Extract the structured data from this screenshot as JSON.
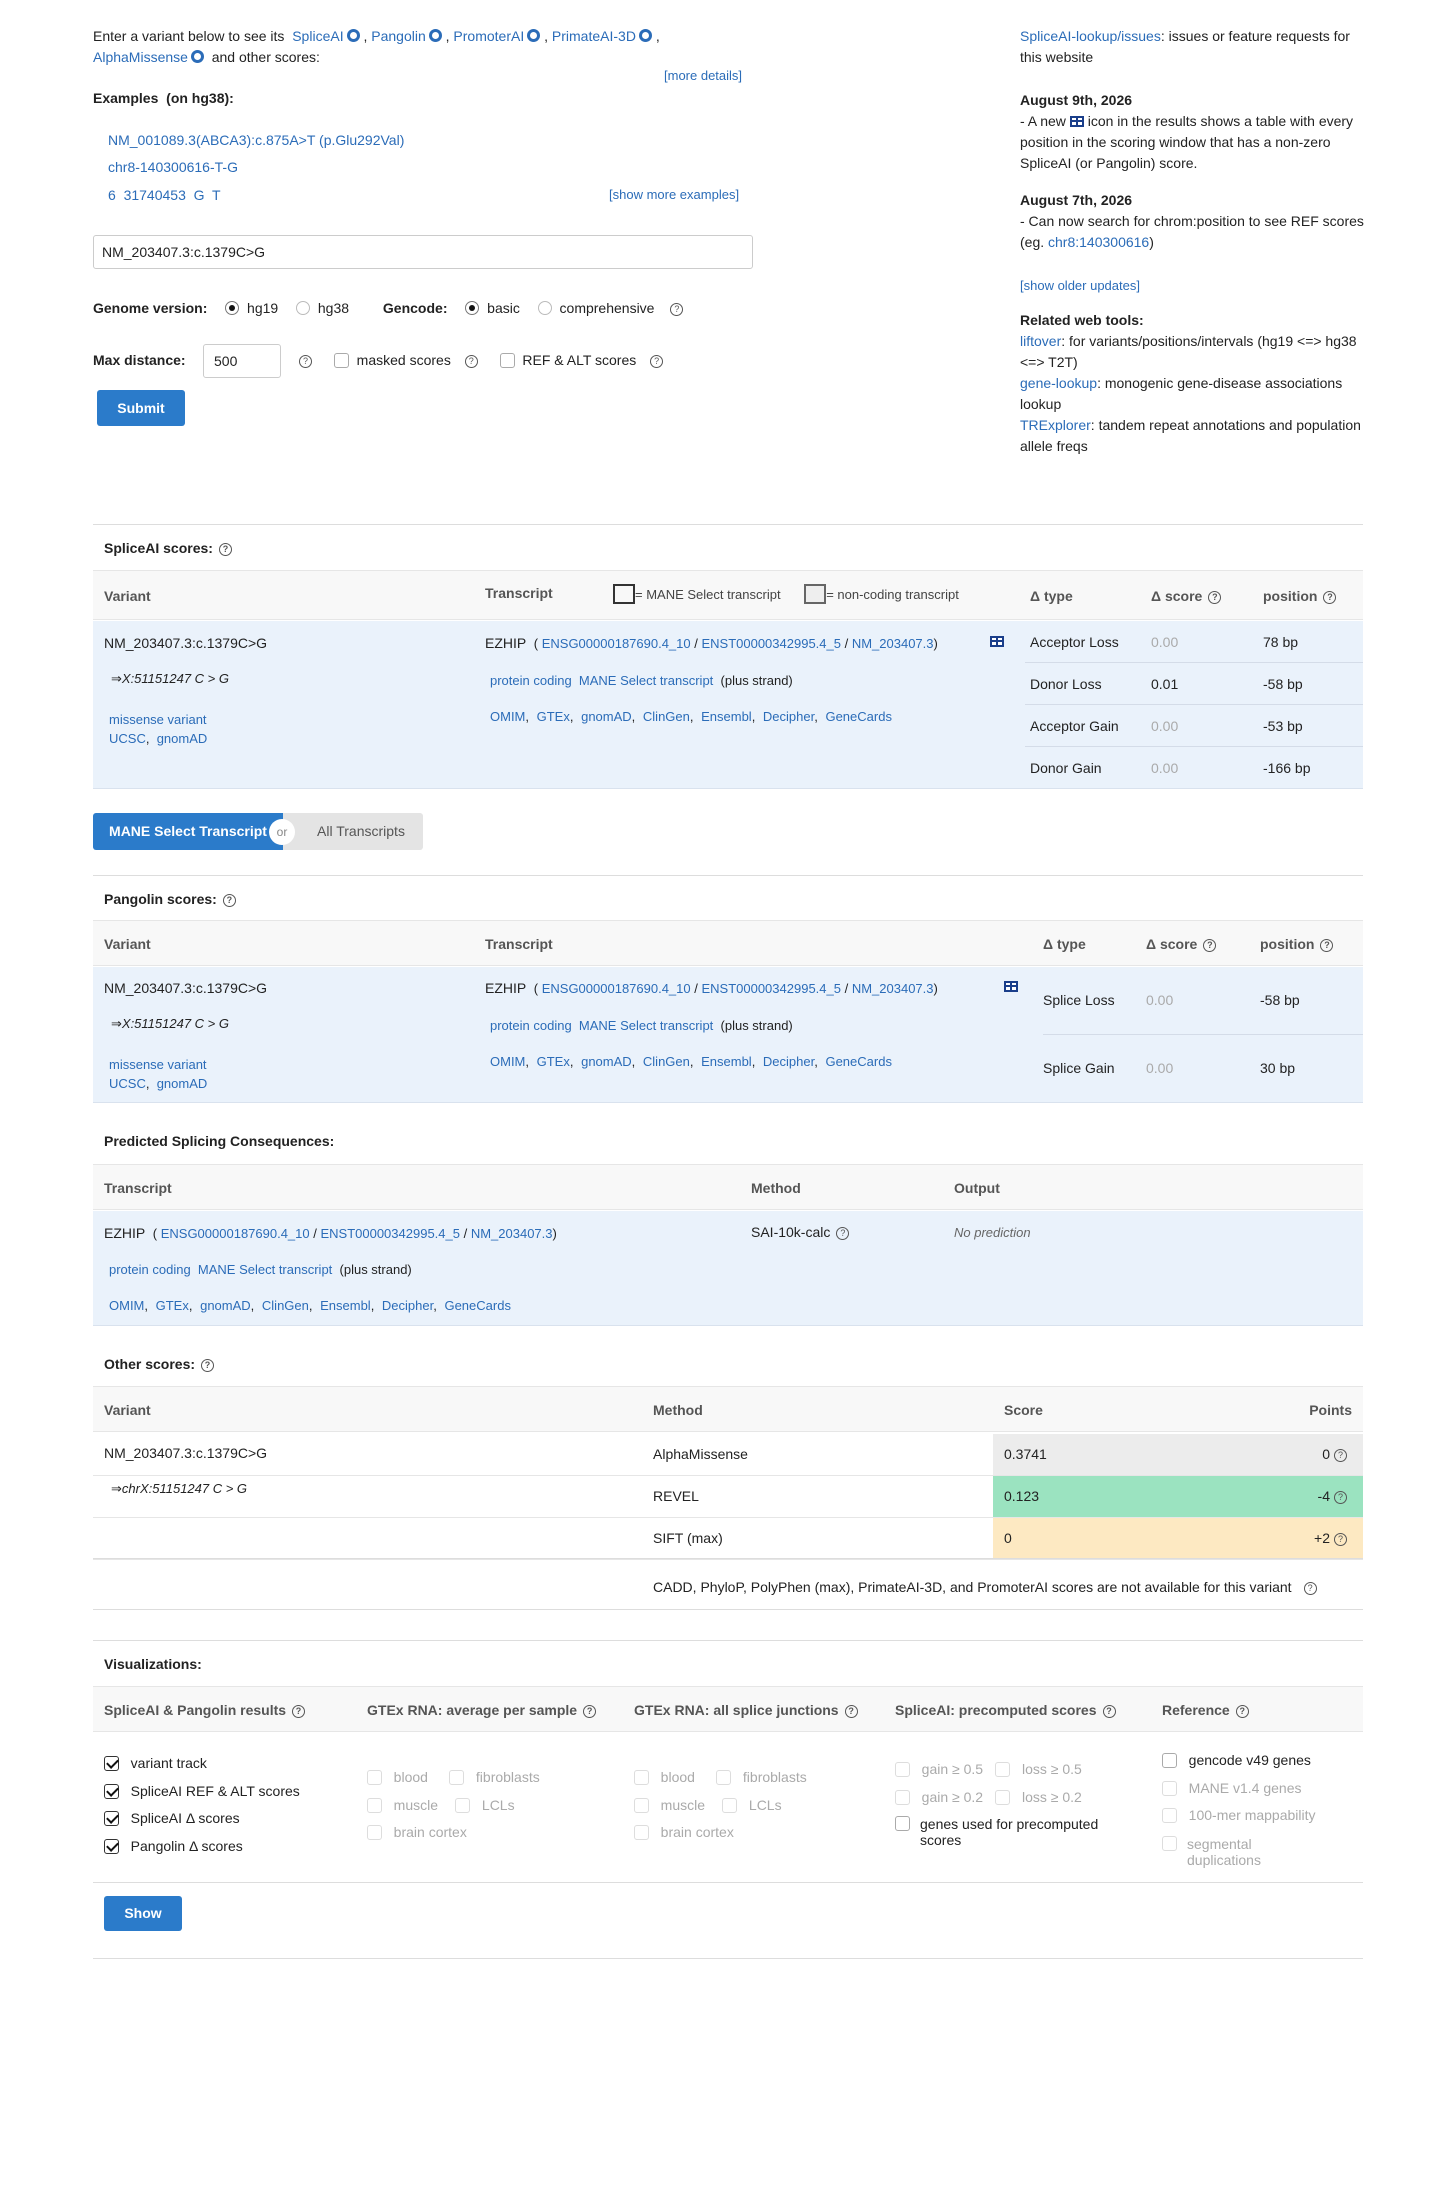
{
  "intro": {
    "prefix": "Enter a variant below to see its",
    "tools": [
      "SpliceAI",
      "Pangolin",
      "PromoterAI",
      "PrimateAI-3D",
      "AlphaMissense"
    ],
    "suffix": "and other scores:",
    "more_details": "[more details]"
  },
  "examples": {
    "title": "Examples",
    "subtitle": "(on hg38):",
    "items": [
      "NM_001089.3(ABCA3):c.875A>T (p.Glu292Val)",
      "chr8-140300616-T-G",
      "6  31740453  G  T"
    ],
    "show_more": "[show more examples]"
  },
  "search": {
    "value": "NM_203407.3:c.1379C>G"
  },
  "genome": {
    "label": "Genome version:",
    "options": [
      "hg19",
      "hg38"
    ],
    "selected": "hg19"
  },
  "gencode": {
    "label": "Gencode:",
    "options": [
      "basic",
      "comprehensive"
    ],
    "selected": "basic"
  },
  "maxdist": {
    "label": "Max distance:",
    "value": "500",
    "masked": "masked scores",
    "refalt": "REF & ALT scores"
  },
  "submit": "Submit",
  "sidebar": {
    "issues_link": "SpliceAI-lookup/issues",
    "issues_text": ": issues or feature requests for this website",
    "u1_date": "August 9th, 2026",
    "u1_a": "- A new",
    "u1_b": "icon in the results shows a table with every position in the scoring window that has a non-zero SpliceAI (or Pangolin) score.",
    "u2_date": "August 7th, 2026",
    "u2_a": "- Can now search for chrom:position to see REF scores (eg.",
    "u2_link": "chr8:140300616",
    "u2_b": ")",
    "older": "[show older updates]",
    "tools_title": "Related web tools:",
    "t1_link": "liftover",
    "t1_text": ": for variants/positions/intervals (hg19 <=> hg38 <=> T2T)",
    "t2_link": "gene-lookup",
    "t2_text": ": monogenic gene-disease associations lookup",
    "t3_link": "TRExplorer",
    "t3_text": ": tandem repeat annotations and population allele freqs"
  },
  "spliceai": {
    "title": "SpliceAI scores:",
    "headers": {
      "variant": "Variant",
      "transcript": "Transcript",
      "mane_legend": "= MANE Select transcript",
      "noncoding_legend": "= non-coding transcript",
      "dtype": "Δ type",
      "dscore": "Δ score",
      "position": "position"
    },
    "rows": [
      {
        "type": "Acceptor Loss",
        "score": "0.00",
        "pos": "78 bp"
      },
      {
        "type": "Donor Loss",
        "score": "0.01",
        "pos": "-58 bp"
      },
      {
        "type": "Acceptor Gain",
        "score": "0.00",
        "pos": "-53 bp"
      },
      {
        "type": "Donor Gain",
        "score": "0.00",
        "pos": "-166 bp"
      }
    ]
  },
  "variant": {
    "hgvs": "NM_203407.3:c.1379C>G",
    "genomic": "⇒X:51151247 C > G",
    "genomic_chr": "⇒chrX:51151247 C > G",
    "consequence": "missense variant",
    "links": [
      "UCSC",
      "gnomAD"
    ]
  },
  "transcript": {
    "gene": "EZHIP",
    "ids": [
      "ENSG00000187690.4_10",
      "ENST00000342995.4_5",
      "NM_203407.3"
    ],
    "biotype": "protein coding",
    "mane": "MANE Select transcript",
    "strand": "(plus strand)",
    "links": [
      "OMIM",
      "GTEx",
      "gnomAD",
      "ClinGen",
      "Ensembl",
      "Decipher",
      "GeneCards"
    ]
  },
  "toggle": {
    "mane": "MANE Select Transcript",
    "or": "or",
    "all": "All Transcripts"
  },
  "pangolin": {
    "title": "Pangolin scores:",
    "rows": [
      {
        "type": "Splice Loss",
        "score": "0.00",
        "pos": "-58 bp"
      },
      {
        "type": "Splice Gain",
        "score": "0.00",
        "pos": "30 bp"
      }
    ]
  },
  "consequences": {
    "title": "Predicted Splicing Consequences:",
    "headers": [
      "Transcript",
      "Method",
      "Output"
    ],
    "method": "SAI-10k-calc",
    "output": "No prediction"
  },
  "other": {
    "title": "Other scores:",
    "headers": [
      "Variant",
      "Method",
      "Score",
      "Points"
    ],
    "rows": [
      {
        "method": "AlphaMissense",
        "score": "0.3741",
        "points": "0",
        "color": "#ececec"
      },
      {
        "method": "REVEL",
        "score": "0.123",
        "points": "-4",
        "color": "#9be3c0"
      },
      {
        "method": "SIFT (max)",
        "score": "0",
        "points": "+2",
        "color": "#fde9c2"
      }
    ],
    "note": "CADD,  PhyloP,  PolyPhen (max),  PrimateAI-3D,  and PromoterAI scores are not available for this variant"
  },
  "viz": {
    "title": "Visualizations:",
    "col1": {
      "title": "SpliceAI & Pangolin results",
      "items": [
        "variant track",
        "SpliceAI REF & ALT scores",
        "SpliceAI Δ  scores",
        "Pangolin Δ  scores"
      ]
    },
    "col2": {
      "title": "GTEx RNA: average per sample",
      "items": [
        "blood",
        "fibroblasts",
        "muscle",
        "LCLs",
        "brain cortex"
      ]
    },
    "col3": {
      "title": "GTEx RNA: all splice junctions",
      "items": [
        "blood",
        "fibroblasts",
        "muscle",
        "LCLs",
        "brain cortex"
      ]
    },
    "col4": {
      "title": "SpliceAI: precomputed scores",
      "items": [
        "gain ≥ 0.5",
        "loss ≥ 0.5",
        "gain ≥ 0.2",
        "loss ≥ 0.2",
        "genes used for precomputed scores"
      ]
    },
    "col5": {
      "title": "Reference",
      "items": [
        "gencode v49 genes",
        "MANE v1.4 genes",
        "100-mer mappability",
        "segmental duplications"
      ]
    },
    "show": "Show"
  }
}
